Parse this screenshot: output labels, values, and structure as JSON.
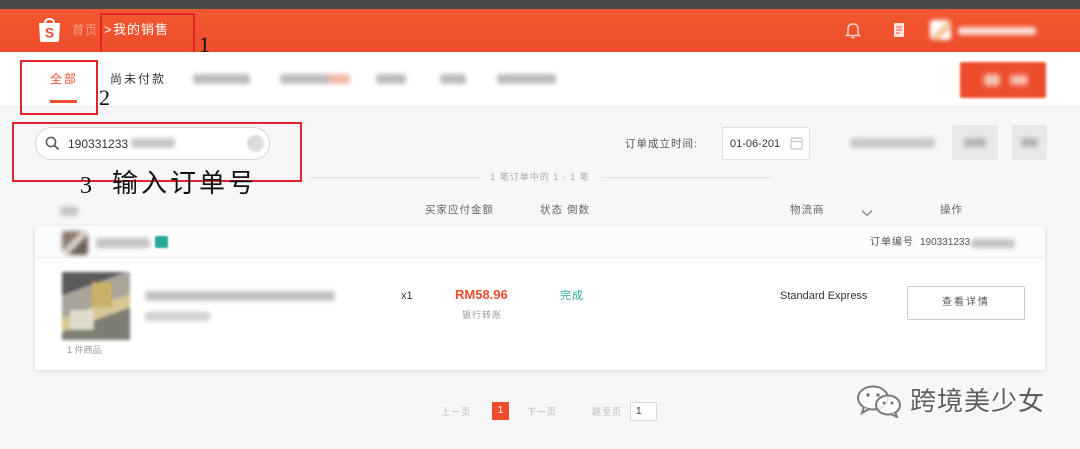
{
  "colors": {
    "brand": "#ee4d2d",
    "success": "#26aa99",
    "annotation": "#e3222b"
  },
  "header": {
    "logo_letter": "S",
    "breadcrumb": {
      "home": "首页",
      "separator": ">",
      "current": "我的销售"
    },
    "icons": [
      "bell-icon",
      "document-icon",
      "avatar"
    ]
  },
  "tabs": [
    {
      "label": "全部",
      "active": true
    },
    {
      "label": "尚未付款",
      "active": false
    }
  ],
  "search": {
    "value": "190331233",
    "icon": "search-icon"
  },
  "filters": {
    "date_label": "订单成立时间:",
    "start_date": "01-06-201",
    "icon": "calendar-icon"
  },
  "summary": "1 笔订单中的 1 - 1 笔",
  "table": {
    "columns": {
      "amount": "买家应付金额",
      "status": "状态",
      "countdown": "倒数",
      "logistics": "物流商",
      "action": "操作"
    },
    "order": {
      "order_no_label": "订单编号",
      "order_no": "190331233",
      "item_count": "1 件商品",
      "item": {
        "quantity": "x1",
        "price": "RM58.96",
        "payment": "银行转账",
        "status": "完成",
        "logistics": "Standard Express",
        "action": "查看详情"
      }
    }
  },
  "pagination": {
    "prev": "上一页",
    "current": "1",
    "next": "下一页",
    "jump_label": "跳至页",
    "jump_value": "1"
  },
  "annotations": {
    "step1": "1",
    "step2": "2",
    "step3_number": "3",
    "step3_text": "输入订单号"
  },
  "watermark": {
    "icon": "wechat-icon",
    "text": "跨境美少女"
  }
}
